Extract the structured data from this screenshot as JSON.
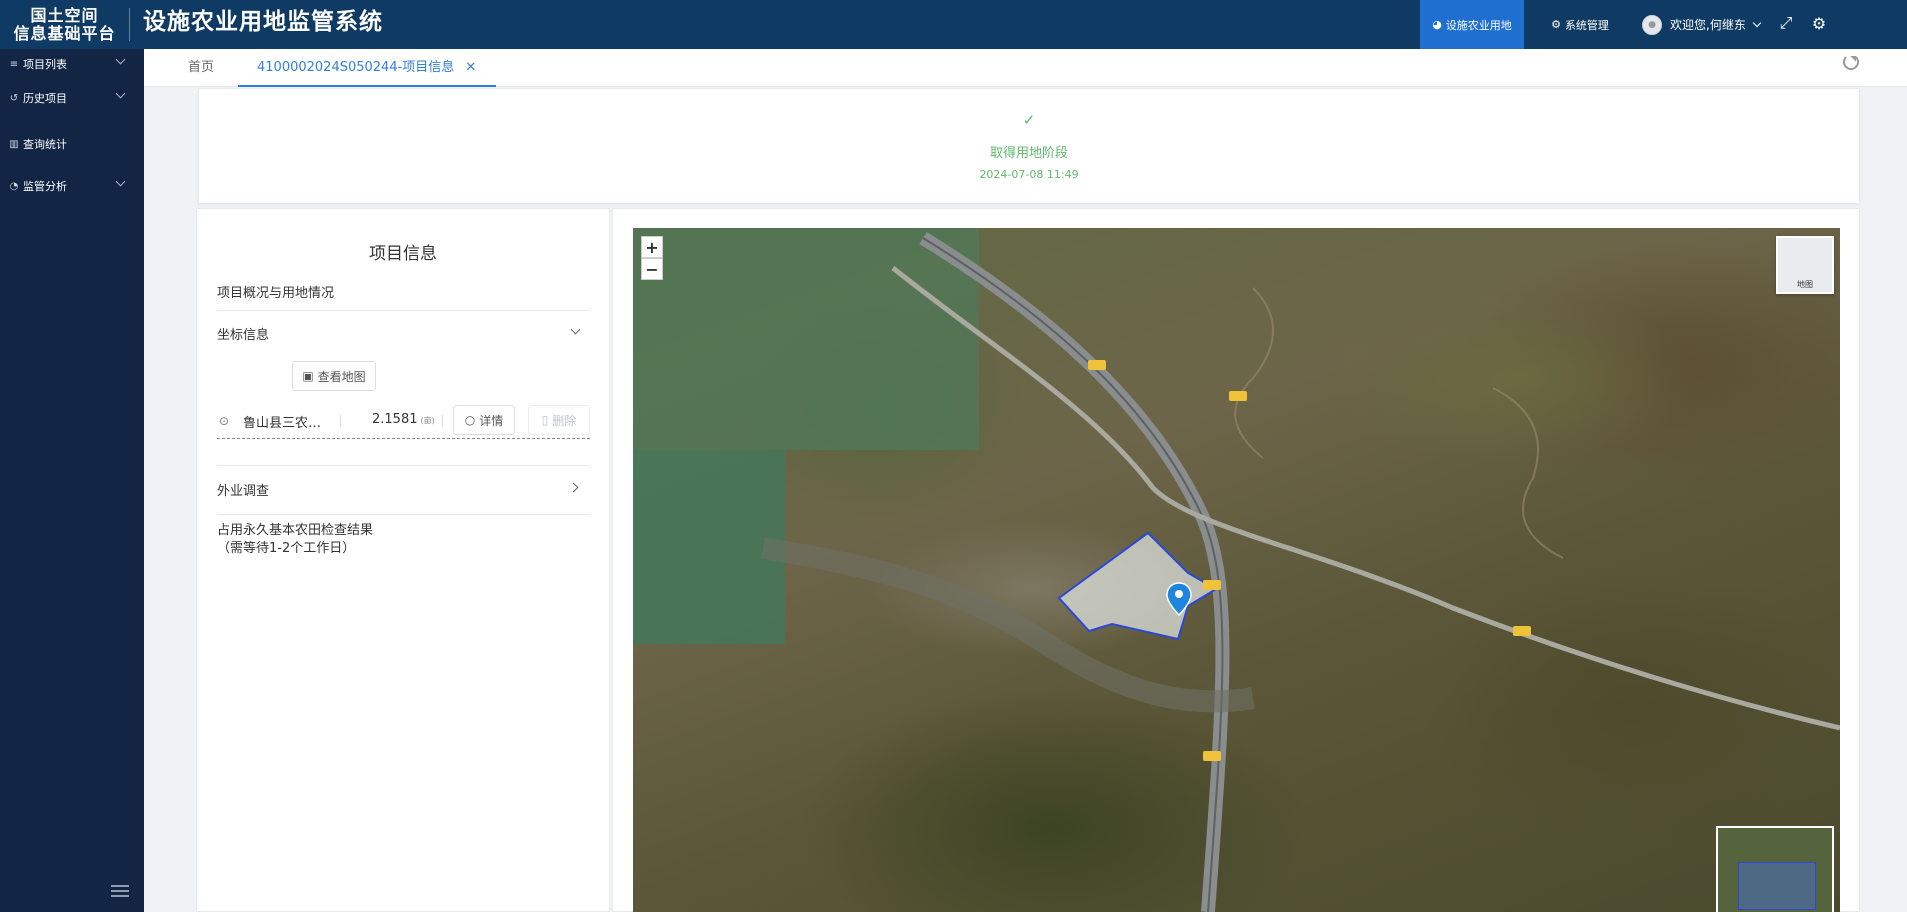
{
  "header": {
    "logo_line1": "国土空间",
    "logo_line2": "信息基础平台",
    "system_title": "设施农业用地监管系统",
    "nav": [
      {
        "label": "设施农业用地",
        "active": true
      },
      {
        "label": "系统管理",
        "active": false
      }
    ],
    "welcome": "欢迎您,何继东"
  },
  "sidebar": {
    "items": [
      {
        "label": "项目列表",
        "icon": "list-icon",
        "expandable": true
      },
      {
        "label": "历史项目",
        "icon": "history-icon",
        "expandable": true
      },
      {
        "label": "查询统计",
        "icon": "chart-icon",
        "expandable": false
      },
      {
        "label": "监管分析",
        "icon": "pie-icon",
        "expandable": true
      }
    ]
  },
  "tabs": [
    {
      "label": "首页",
      "active": false
    },
    {
      "label": "4100002024S050244-项目信息",
      "active": true
    }
  ],
  "stage": {
    "status": "取得用地阶段",
    "time": "2024-07-08 11:49"
  },
  "info": {
    "title": "项目信息",
    "overview_label": "项目概况与用地情况",
    "coord_label": "坐标信息",
    "view_map_button": "查看地图",
    "coord_item": {
      "name": "鲁山县三农…",
      "area": "2.1581",
      "unit": "(亩)",
      "detail_button": "详情",
      "delete_button": "删除"
    },
    "survey_label": "外业调查",
    "farmland_check_line1": "占用永久基本农田检查结果",
    "farmland_check_line2": "（需等待1-2个工作日）"
  },
  "map": {
    "zoom_in": "+",
    "zoom_out": "−",
    "layer_label": "地图",
    "colors": {
      "polygon_stroke": "#2b48d6",
      "polygon_fill": "#d8dcd6",
      "marker": "#1f86e0"
    }
  }
}
